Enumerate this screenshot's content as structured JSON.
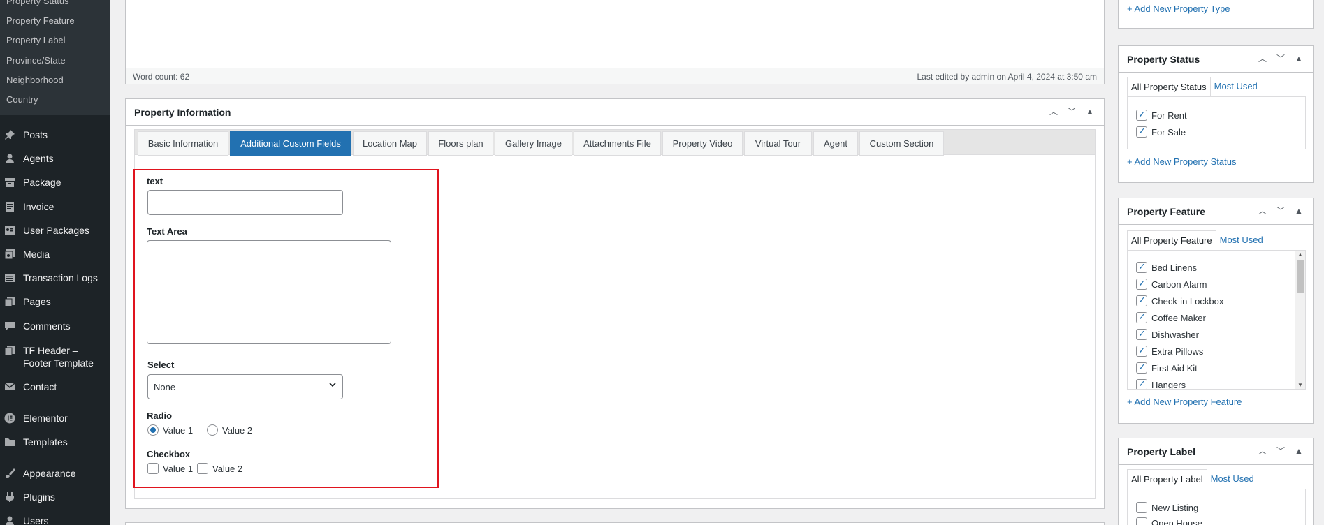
{
  "sidebar": {
    "submenu": [
      "Property Status",
      "Property Feature",
      "Property Label",
      "Province/State",
      "Neighborhood",
      "Country"
    ],
    "menu": [
      {
        "label": "Posts",
        "icon": "pin-icon"
      },
      {
        "label": "Agents",
        "icon": "person-icon"
      },
      {
        "label": "Package",
        "icon": "archive-icon"
      },
      {
        "label": "Invoice",
        "icon": "document-icon"
      },
      {
        "label": "User Packages",
        "icon": "id-card-icon"
      },
      {
        "label": "Media",
        "icon": "media-icon"
      },
      {
        "label": "Transaction Logs",
        "icon": "list-icon"
      },
      {
        "label": "Pages",
        "icon": "pages-icon"
      },
      {
        "label": "Comments",
        "icon": "comment-icon"
      },
      {
        "label": "TF Header – Footer Template",
        "line1": "TF Header –",
        "line2": "Footer Template",
        "icon": "template-icon"
      },
      {
        "label": "Contact",
        "icon": "mail-icon"
      },
      {
        "label": "Elementor",
        "icon": "elementor-icon"
      },
      {
        "label": "Templates",
        "icon": "folder-icon"
      },
      {
        "label": "Appearance",
        "icon": "brush-icon"
      },
      {
        "label": "Plugins",
        "icon": "plugin-icon"
      },
      {
        "label": "Users",
        "icon": "users-icon"
      }
    ]
  },
  "editor": {
    "word_count": "Word count: 62",
    "last_edited": "Last edited by admin on April 4, 2024 at 3:50 am"
  },
  "property_info": {
    "title": "Property Information",
    "tabs": [
      "Basic Information",
      "Additional Custom Fields",
      "Location Map",
      "Floors plan",
      "Gallery Image",
      "Attachments File",
      "Property Video",
      "Virtual Tour",
      "Agent",
      "Custom Section"
    ],
    "active_tab": "Additional Custom Fields",
    "fields": {
      "text_label": "text",
      "text_value": "",
      "textarea_label": "Text Area",
      "textarea_value": "",
      "select_label": "Select",
      "select_value": "None",
      "radio_label": "Radio",
      "radio_options": [
        "Value 1",
        "Value 2"
      ],
      "radio_selected": "Value 1",
      "checkbox_label": "Checkbox",
      "checkbox_options": [
        "Value 1",
        "Value 2"
      ]
    }
  },
  "right": {
    "add_property_type": "+ Add New Property Type",
    "status": {
      "title": "Property Status",
      "tab_all": "All Property Status",
      "tab_most": "Most Used",
      "items": [
        "For Rent",
        "For Sale"
      ],
      "add": "+ Add New Property Status"
    },
    "feature": {
      "title": "Property Feature",
      "tab_all": "All Property Feature",
      "tab_most": "Most Used",
      "items": [
        "Bed Linens",
        "Carbon Alarm",
        "Check-in Lockbox",
        "Coffee Maker",
        "Dishwasher",
        "Extra Pillows",
        "First Aid Kit",
        "Hangers"
      ],
      "add": "+ Add New Property Feature"
    },
    "label": {
      "title": "Property Label",
      "tab_all": "All Property Label",
      "tab_most": "Most Used",
      "items": [
        "New Listing",
        "Open House"
      ]
    }
  },
  "colors": {
    "accent": "#2271b1",
    "highlight": "#e0141e",
    "sidebar": "#1d2327"
  }
}
